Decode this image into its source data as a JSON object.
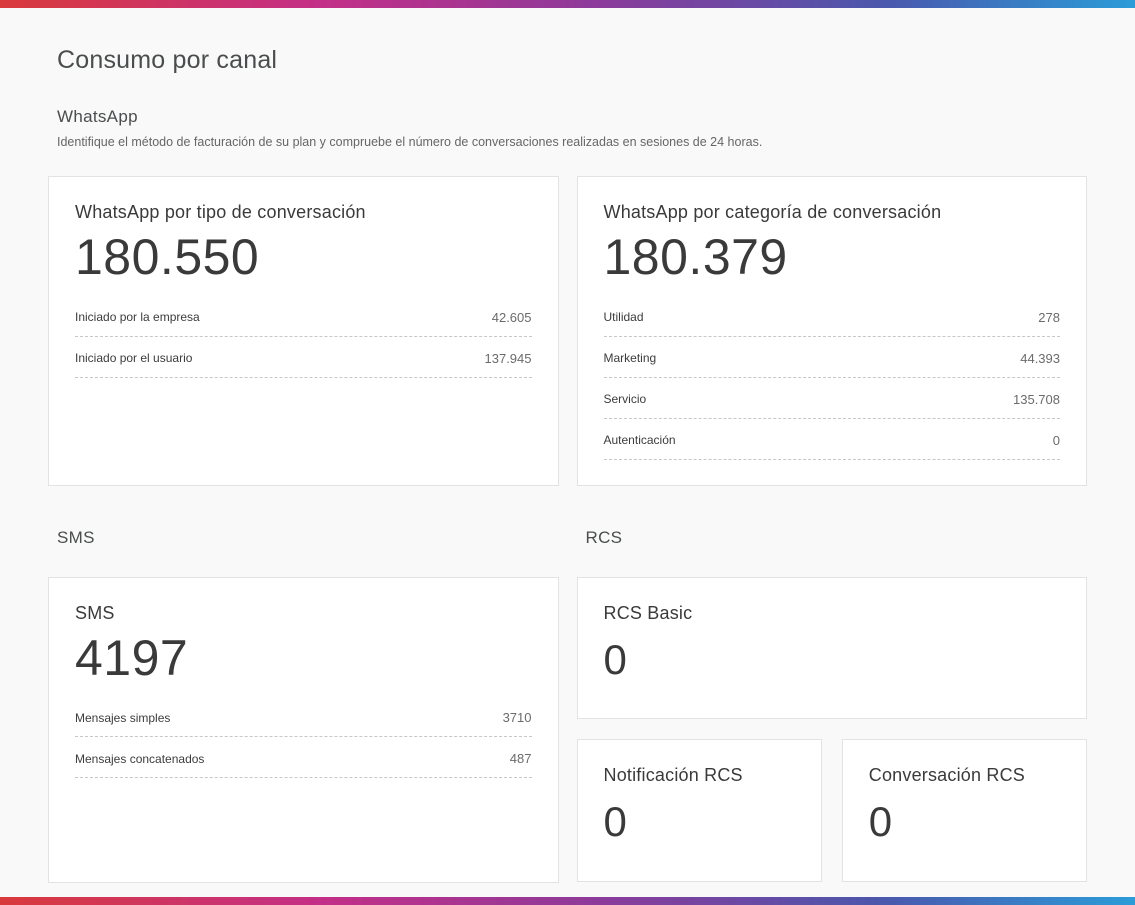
{
  "accent": {
    "gradient": [
      "#d93a3c 0%",
      "#c42f87 28%",
      "#8e3a9a 52%",
      "#4a58ad 78%",
      "#2b9cd8 100%"
    ]
  },
  "page": {
    "title": "Consumo por canal"
  },
  "whatsapp": {
    "heading": "WhatsApp",
    "description": "Identifique el método de facturación de su plan y compruebe el número de conversaciones realizadas en sesiones de 24 horas.",
    "type_card": {
      "title": "WhatsApp por tipo de conversación",
      "total": "180.550",
      "rows": [
        {
          "label": "Iniciado por la empresa",
          "value": "42.605"
        },
        {
          "label": "Iniciado por el usuario",
          "value": "137.945"
        }
      ]
    },
    "category_card": {
      "title": "WhatsApp por categoría de conversación",
      "total": "180.379",
      "rows": [
        {
          "label": "Utilidad",
          "value": "278"
        },
        {
          "label": "Marketing",
          "value": "44.393"
        },
        {
          "label": "Servicio",
          "value": "135.708"
        },
        {
          "label": "Autenticación",
          "value": "0"
        }
      ]
    }
  },
  "sms": {
    "heading": "SMS",
    "card": {
      "title": "SMS",
      "total": "4197",
      "rows": [
        {
          "label": "Mensajes simples",
          "value": "3710"
        },
        {
          "label": "Mensajes concatenados",
          "value": "487"
        }
      ]
    }
  },
  "rcs": {
    "heading": "RCS",
    "basic_card": {
      "title": "RCS Basic",
      "total": "0"
    },
    "notification_card": {
      "title": "Notificación RCS",
      "total": "0"
    },
    "conversation_card": {
      "title": "Conversación RCS",
      "total": "0"
    }
  }
}
